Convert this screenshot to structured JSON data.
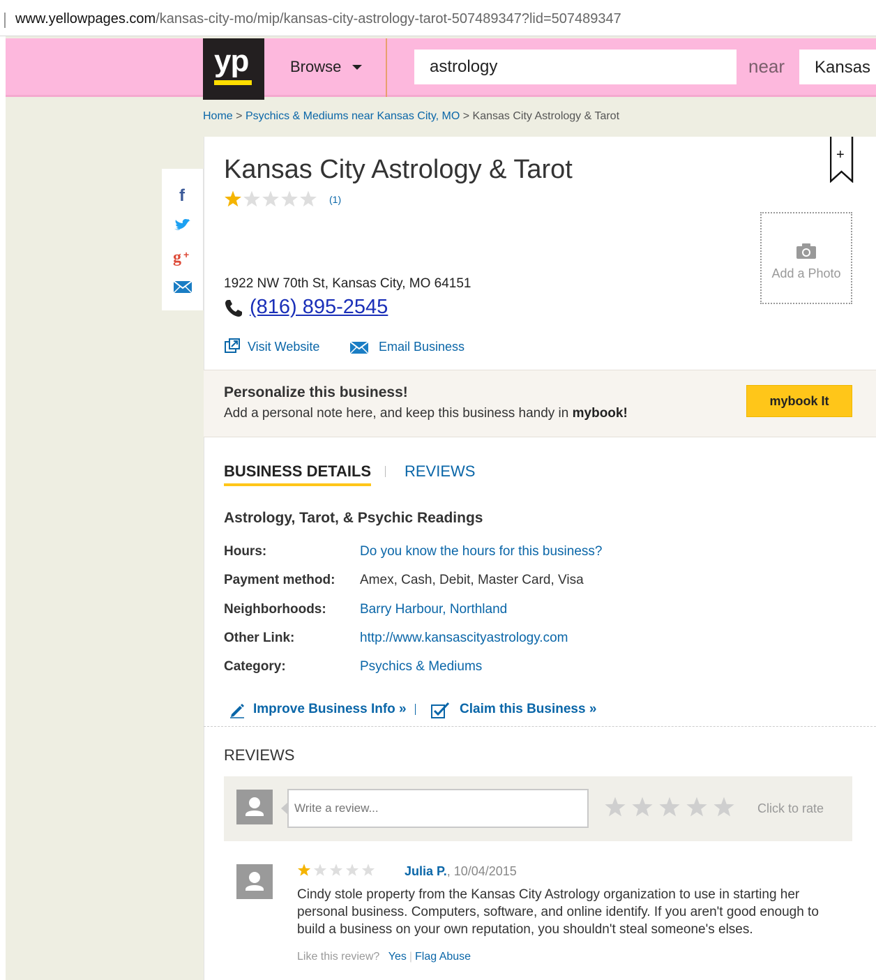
{
  "browser": {
    "url_domain": "www.yellowpages.com",
    "url_path": "/kansas-city-mo/mip/kansas-city-astrology-tarot-507489347?lid=507489347"
  },
  "header": {
    "logo_text": "yp",
    "browse_label": "Browse",
    "search_value": "astrology",
    "near_label": "near",
    "location_value": "Kansas"
  },
  "breadcrumb": {
    "home": "Home",
    "sep1": ">",
    "category": "Psychics & Mediums near Kansas City, MO",
    "sep2": ">",
    "current": "Kansas City Astrology & Tarot"
  },
  "business": {
    "name": "Kansas City Astrology & Tarot",
    "rating": 1,
    "rating_max": 5,
    "review_count": "(1)",
    "address": "1922 NW 70th St, Kansas City, MO 64151",
    "phone": "(816) 895-2545",
    "visit_website": "Visit Website",
    "email_business": "Email Business",
    "add_photo": "Add a Photo",
    "bookmark_symbol": "+"
  },
  "personalize": {
    "title": "Personalize this business!",
    "sub_prefix": "Add a personal note here, and keep this business handy in ",
    "sub_bold": "mybook!",
    "button": "mybook It"
  },
  "tabs": {
    "details": "BUSINESS DETAILS",
    "reviews": "REVIEWS"
  },
  "details": {
    "category_heading": "Astrology, Tarot, & Psychic Readings",
    "rows": [
      {
        "label": "Hours:",
        "value": "Do you know the hours for this business?"
      },
      {
        "label": "Payment method:",
        "value": "Amex, Cash, Debit, Master Card, Visa"
      },
      {
        "label": "Neighborhoods:",
        "value": "Barry Harbour, Northland"
      },
      {
        "label": "Other Link:",
        "value": "http://www.kansascityastrology.com"
      },
      {
        "label": "Category:",
        "value": "Psychics & Mediums"
      }
    ],
    "improve": "Improve Business Info »",
    "claim": "Claim this Business »"
  },
  "reviews": {
    "heading": "REVIEWS",
    "write_placeholder": "Write a review...",
    "click_to_rate": "Click to rate",
    "items": [
      {
        "rating": 1,
        "author": "Julia P.",
        "date": ", 10/04/2015",
        "text": "Cindy stole property from the Kansas City Astrology organization to use in starting her personal business. Computers, software, and online identify. If you aren't good enough to build a business on your own reputation, you shouldn't steal someone's elses.",
        "like_prompt": "Like this review?",
        "yes": "Yes",
        "flag": "Flag Abuse"
      }
    ]
  },
  "colors": {
    "header_pink": "#fdb8dd",
    "accent_yellow": "#ffc619",
    "link_blue": "#0a66a8",
    "phone_blue": "#1a2fb8"
  }
}
